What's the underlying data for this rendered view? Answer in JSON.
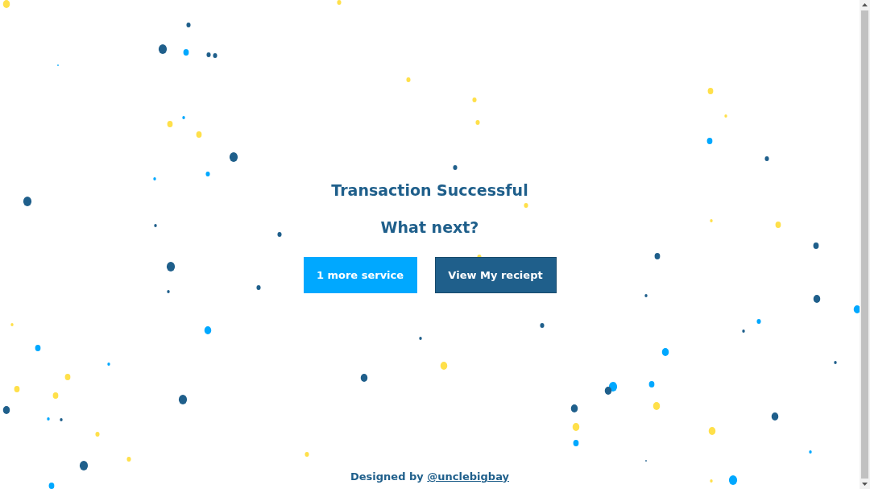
{
  "title": "Transaction Successful",
  "subtitle": "What next?",
  "buttons": [
    {
      "label": "1 more service",
      "kind": "primary"
    },
    {
      "label": "View My reciept",
      "kind": "secondary"
    }
  ],
  "footer": {
    "text": "Designed by",
    "link": "@unclebigbay"
  }
}
